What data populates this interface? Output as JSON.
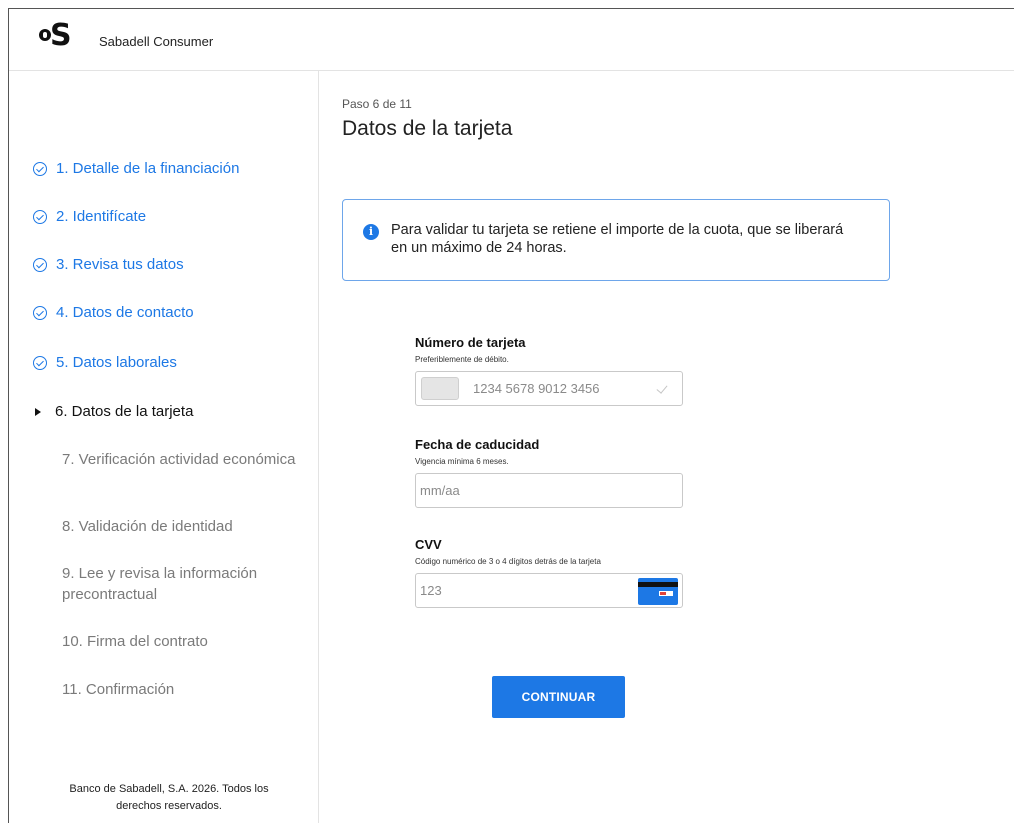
{
  "header": {
    "brand": "Sabadell Consumer",
    "logo_icon": "sabadell-bs-logo"
  },
  "sidebar": {
    "steps": [
      {
        "label": "1. Detalle de la financiación",
        "state": "done"
      },
      {
        "label": "2. Identifícate",
        "state": "done"
      },
      {
        "label": "3. Revisa tus datos",
        "state": "done"
      },
      {
        "label": "4. Datos de contacto",
        "state": "done"
      },
      {
        "label": "5. Datos laborales",
        "state": "done"
      },
      {
        "label": "6. Datos de la tarjeta",
        "state": "current"
      },
      {
        "label": "7. Verificación actividad económica",
        "state": "todo"
      },
      {
        "label": "8. Validación de identidad",
        "state": "todo"
      },
      {
        "label": "9. Lee y revisa la información precontractual",
        "state": "todo"
      },
      {
        "label": "10. Firma del contrato",
        "state": "todo"
      },
      {
        "label": "11. Confirmación",
        "state": "todo"
      }
    ],
    "footer": "Banco de Sabadell, S.A. 2026. Todos los derechos reservados."
  },
  "main": {
    "step_indicator": "Paso 6 de 11",
    "title": "Datos de la tarjeta",
    "info_message": "Para validar tu tarjeta se retiene el importe de la cuota, que se liberará en un máximo de 24 horas.",
    "card_number": {
      "label": "Número de tarjeta",
      "help": "Preferiblemente de débito.",
      "placeholder": "1234 5678 9012 3456"
    },
    "expiry": {
      "label": "Fecha de caducidad",
      "help": "Vigencia mínima 6 meses.",
      "placeholder": "mm/aa"
    },
    "cvv": {
      "label": "CVV",
      "help": "Código numérico de 3 o 4 dígitos detrás de la tarjeta",
      "placeholder": "123"
    },
    "continue_label": "CONTINUAR"
  },
  "colors": {
    "accent": "#1d78e5",
    "muted_text": "#7a7a7a",
    "border": "#c9c9c9"
  }
}
